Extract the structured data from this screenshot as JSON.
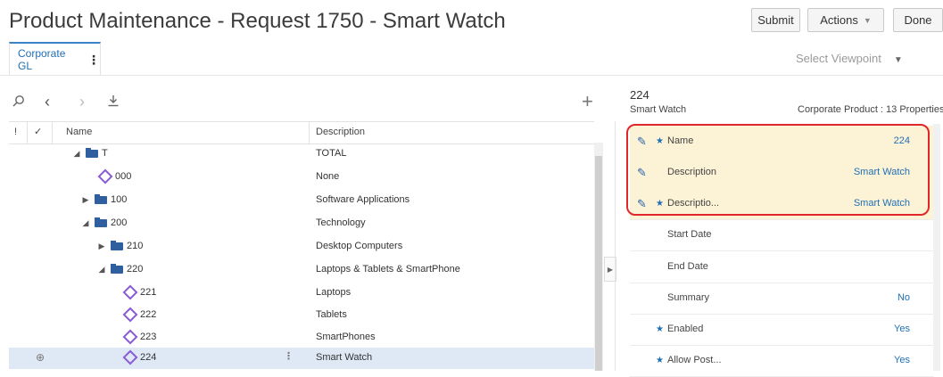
{
  "header": {
    "title": "Product Maintenance - Request 1750 - Smart Watch",
    "submit_label": "Submit",
    "actions_label": "Actions",
    "done_label": "Done"
  },
  "tabs": [
    {
      "label": "Corporate GL"
    }
  ],
  "viewpoint": {
    "label": "Select Viewpoint"
  },
  "grid": {
    "columns": {
      "name": "Name",
      "description": "Description"
    },
    "rows": [
      {
        "name": "T",
        "description": "TOTAL",
        "type": "folder",
        "state": "expanded"
      },
      {
        "name": "000",
        "description": "None",
        "type": "leaf"
      },
      {
        "name": "100",
        "description": "Software Applications",
        "type": "folder",
        "state": "collapsed"
      },
      {
        "name": "200",
        "description": "Technology",
        "type": "folder",
        "state": "expanded"
      },
      {
        "name": "210",
        "description": "Desktop Computers",
        "type": "folder",
        "state": "collapsed"
      },
      {
        "name": "220",
        "description": "Laptops & Tablets & SmartPhone",
        "type": "folder",
        "state": "expanded"
      },
      {
        "name": "221",
        "description": "Laptops",
        "type": "leaf"
      },
      {
        "name": "222",
        "description": "Tablets",
        "type": "leaf"
      },
      {
        "name": "223",
        "description": "SmartPhones",
        "type": "leaf"
      },
      {
        "name": "224",
        "description": "Smart Watch",
        "type": "leaf",
        "selected": true
      }
    ]
  },
  "properties": {
    "id": "224",
    "name": "Smart Watch",
    "class_label": "Corporate Product : 13 Properties",
    "items": [
      {
        "label": "Name",
        "value": "224",
        "required": true,
        "editable": true
      },
      {
        "label": "Description",
        "value": "Smart Watch",
        "required": false,
        "editable": true
      },
      {
        "label": "Descriptio...",
        "value": "Smart Watch",
        "required": true,
        "editable": true
      },
      {
        "label": "Start Date",
        "value": "",
        "required": false,
        "editable": false
      },
      {
        "label": "End Date",
        "value": "",
        "required": false,
        "editable": false
      },
      {
        "label": "Summary",
        "value": "No",
        "required": false,
        "editable": false
      },
      {
        "label": "Enabled",
        "value": "Yes",
        "required": true,
        "editable": false
      },
      {
        "label": "Allow Post...",
        "value": "Yes",
        "required": true,
        "editable": false
      }
    ]
  },
  "icons": [
    "search-icon",
    "back-icon",
    "forward-icon",
    "download-icon",
    "add-icon",
    "flag-icon",
    "check-icon",
    "kebab-icon",
    "pencil-icon",
    "caret-down-icon"
  ],
  "colors": {
    "accent": "#1f6fb6",
    "highlight": "#fcf2d6",
    "callout": "#e0262b",
    "leaf": "#8a5bd6",
    "folder": "#2f5f9e"
  }
}
